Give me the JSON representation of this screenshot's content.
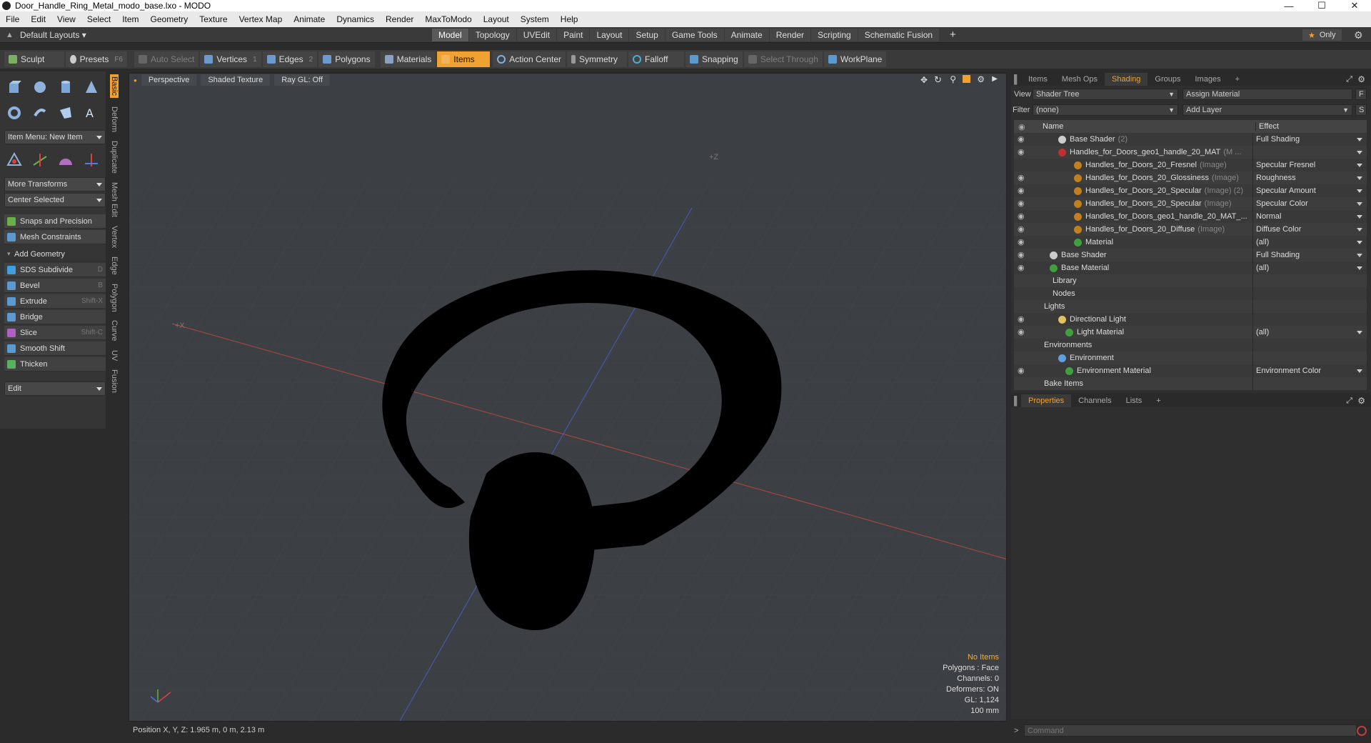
{
  "window": {
    "title": "Door_Handle_Ring_Metal_modo_base.lxo - MODO"
  },
  "menus": [
    "File",
    "Edit",
    "View",
    "Select",
    "Item",
    "Geometry",
    "Texture",
    "Vertex Map",
    "Animate",
    "Dynamics",
    "Render",
    "MaxToModo",
    "Layout",
    "System",
    "Help"
  ],
  "layout": {
    "default_layouts": "Default Layouts",
    "tabs": [
      "Model",
      "Topology",
      "UVEdit",
      "Paint",
      "Layout",
      "Setup",
      "Game Tools",
      "Animate",
      "Render",
      "Scripting",
      "Schematic Fusion"
    ],
    "active_tab": "Model",
    "only_label": "Only"
  },
  "toolbar": {
    "sculpt": "Sculpt",
    "presets": "Presets",
    "presets_key": "F6",
    "auto_select": "Auto Select",
    "vertices": "Vertices",
    "vertices_n": "1",
    "edges": "Edges",
    "edges_n": "2",
    "polygons": "Polygons",
    "materials": "Materials",
    "items": "Items",
    "action_center": "Action Center",
    "symmetry": "Symmetry",
    "falloff": "Falloff",
    "snapping": "Snapping",
    "select_through": "Select Through",
    "workplane": "WorkPlane"
  },
  "left": {
    "vtabs": [
      "Basic",
      "Deform",
      "Duplicate",
      "Mesh Edit",
      "Vertex",
      "Edge",
      "Polygon",
      "Curve",
      "UV",
      "Fusion"
    ],
    "item_menu": "Item Menu: New Item",
    "more_transforms": "More Transforms",
    "center_selected": "Center Selected",
    "snaps": "Snaps and Precision",
    "mesh_constraints": "Mesh Constraints",
    "add_geometry": "Add Geometry",
    "tools": [
      {
        "label": "SDS Subdivide",
        "key": "D",
        "color": "#3fa0e0"
      },
      {
        "label": "Bevel",
        "key": "B",
        "color": "#5a9ad0"
      },
      {
        "label": "Extrude",
        "key": "Shift-X",
        "color": "#5a9ad0"
      },
      {
        "label": "Bridge",
        "key": "",
        "color": "#5a9ad0"
      },
      {
        "label": "Slice",
        "key": "Shift-C",
        "color": "#b060c0"
      },
      {
        "label": "Smooth Shift",
        "key": "",
        "color": "#5a9ad0"
      },
      {
        "label": "Thicken",
        "key": "",
        "color": "#5ab060"
      }
    ],
    "edit": "Edit"
  },
  "viewport": {
    "perspective": "Perspective",
    "shading": "Shaded Texture",
    "raygl": "Ray GL: Off",
    "stats": {
      "items": "No Items",
      "polygons": "Polygons : Face",
      "channels": "Channels: 0",
      "deformers": "Deformers: ON",
      "gl": "GL: 1,124",
      "scale": "100 mm"
    },
    "axis_label_z": "+Z",
    "axis_label_x": "+X"
  },
  "status": {
    "position": "Position X, Y, Z:  1.965 m, 0 m, 2.13 m"
  },
  "right": {
    "tabs": [
      "Items",
      "Mesh Ops",
      "Shading",
      "Groups",
      "Images"
    ],
    "active_tab": "Shading",
    "view_label": "View",
    "view_value": "Shader Tree",
    "assign_material": "Assign Material",
    "f_btn": "F",
    "filter_label": "Filter",
    "filter_value": "(none)",
    "add_layer": "Add Layer",
    "s_btn": "S",
    "col_name": "Name",
    "col_effect": "Effect",
    "rows": [
      {
        "name": "Base Shader",
        "suffix": "(2)",
        "effect": "Full Shading",
        "indent": 62,
        "ball": "#ccc",
        "eye": true,
        "dd": true
      },
      {
        "name": "Handles_for_Doors_geo1_handle_20_MAT",
        "suffix": "(M ...",
        "effect": "",
        "indent": 62,
        "ball": "#c03030",
        "eye": true,
        "dd": true
      },
      {
        "name": "Handles_for_Doors_20_Fresnel",
        "suffix": "(Image)",
        "effect": "Specular Fresnel",
        "indent": 84,
        "ball": "#c08020",
        "eye": false,
        "dd": true
      },
      {
        "name": "Handles_for_Doors_20_Glossiness",
        "suffix": "(Image)",
        "effect": "Roughness",
        "indent": 84,
        "ball": "#c08020",
        "eye": true,
        "dd": true
      },
      {
        "name": "Handles_for_Doors_20_Specular",
        "suffix": "(Image) (2)",
        "effect": "Specular Amount",
        "indent": 84,
        "ball": "#c08020",
        "eye": true,
        "dd": true
      },
      {
        "name": "Handles_for_Doors_20_Specular",
        "suffix": "(Image)",
        "effect": "Specular Color",
        "indent": 84,
        "ball": "#c08020",
        "eye": true,
        "dd": true
      },
      {
        "name": "Handles_for_Doors_geo1_handle_20_MAT_...",
        "suffix": "",
        "effect": "Normal",
        "indent": 84,
        "ball": "#c08020",
        "eye": true,
        "dd": true
      },
      {
        "name": "Handles_for_Doors_20_Diffuse",
        "suffix": "(Image)",
        "effect": "Diffuse Color",
        "indent": 84,
        "ball": "#c08020",
        "eye": true,
        "dd": true
      },
      {
        "name": "Material",
        "suffix": "",
        "effect": "(all)",
        "indent": 84,
        "ball": "#40a040",
        "eye": true,
        "dd": true
      },
      {
        "name": "Base Shader",
        "suffix": "",
        "effect": "Full Shading",
        "indent": 50,
        "ball": "#ccc",
        "eye": true,
        "dd": true
      },
      {
        "name": "Base Material",
        "suffix": "",
        "effect": "(all)",
        "indent": 50,
        "ball": "#40a040",
        "eye": true,
        "dd": true
      },
      {
        "name": "Library",
        "suffix": "",
        "effect": "",
        "indent": 54,
        "ball": "",
        "eye": false,
        "dd": false
      },
      {
        "name": "Nodes",
        "suffix": "",
        "effect": "",
        "indent": 54,
        "ball": "",
        "eye": false,
        "dd": false
      },
      {
        "name": "Lights",
        "suffix": "",
        "effect": "",
        "indent": 42,
        "ball": "",
        "eye": false,
        "dd": false
      },
      {
        "name": "Directional Light",
        "suffix": "",
        "effect": "",
        "indent": 62,
        "ball": "#e0c060",
        "eye": true,
        "dd": false
      },
      {
        "name": "Light Material",
        "suffix": "",
        "effect": "(all)",
        "indent": 72,
        "ball": "#40a040",
        "eye": true,
        "dd": true
      },
      {
        "name": "Environments",
        "suffix": "",
        "effect": "",
        "indent": 42,
        "ball": "",
        "eye": false,
        "dd": false
      },
      {
        "name": "Environment",
        "suffix": "",
        "effect": "",
        "indent": 62,
        "ball": "#60a0e0",
        "eye": false,
        "dd": false
      },
      {
        "name": "Environment Material",
        "suffix": "",
        "effect": "Environment Color",
        "indent": 72,
        "ball": "#40a040",
        "eye": true,
        "dd": true
      },
      {
        "name": "Bake Items",
        "suffix": "",
        "effect": "",
        "indent": 42,
        "ball": "",
        "eye": false,
        "dd": false
      }
    ],
    "prop_tabs": [
      "Properties",
      "Channels",
      "Lists"
    ],
    "command_placeholder": "Command"
  }
}
